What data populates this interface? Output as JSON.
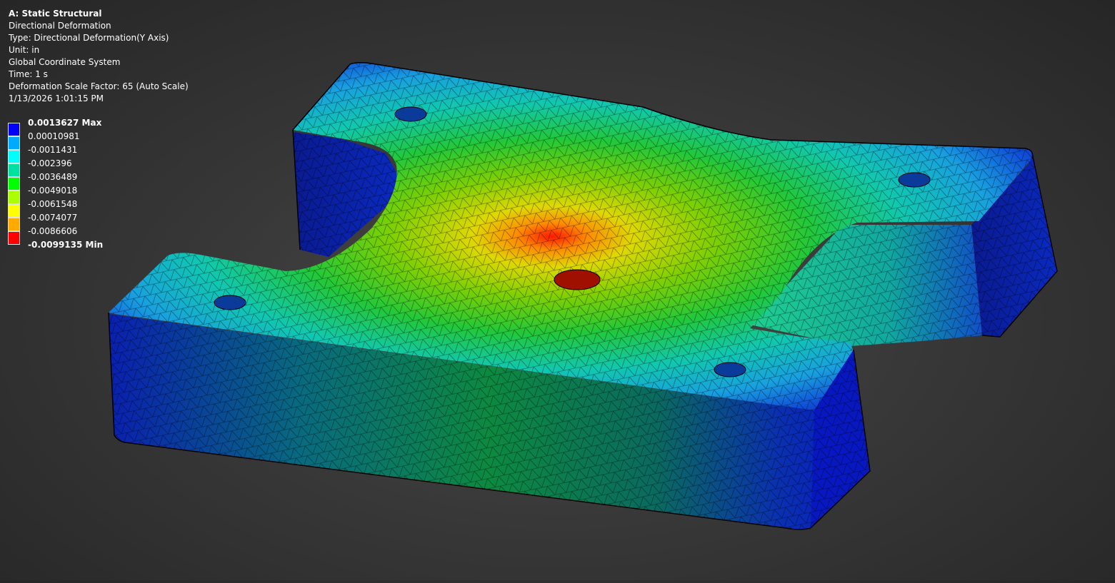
{
  "info": {
    "title": "A: Static Structural",
    "result_name": "Directional Deformation",
    "type": "Type: Directional Deformation(Y Axis)",
    "unit": "Unit: in",
    "coordinate_system": "Global Coordinate System",
    "time": "Time: 1 s",
    "scale_factor": "Deformation Scale Factor: 65 (Auto Scale)",
    "timestamp": "1/13/2026 1:01:15 PM"
  },
  "legend": {
    "levels": [
      {
        "label": "0.0013627 Max",
        "bold": true,
        "color": "#0000ff"
      },
      {
        "label": "0.00010981",
        "bold": false,
        "color": "#00aaff"
      },
      {
        "label": "-0.0011431",
        "bold": false,
        "color": "#00ffff"
      },
      {
        "label": "-0.002396",
        "bold": false,
        "color": "#00e0a0"
      },
      {
        "label": "-0.0036489",
        "bold": false,
        "color": "#00ff00"
      },
      {
        "label": "-0.0049018",
        "bold": false,
        "color": "#aaff00"
      },
      {
        "label": "-0.0061548",
        "bold": false,
        "color": "#ffff00"
      },
      {
        "label": "-0.0074077",
        "bold": false,
        "color": "#ffaa00"
      },
      {
        "label": "-0.0086606",
        "bold": false,
        "color": "#ff0000"
      },
      {
        "label": "-0.0099135 Min",
        "bold": true,
        "color": ""
      }
    ]
  },
  "model": {
    "description_icon": "fem-mesh-part",
    "colors": {
      "max": "#0000ff",
      "mid": "#00ff00",
      "min": "#ff0000"
    }
  }
}
